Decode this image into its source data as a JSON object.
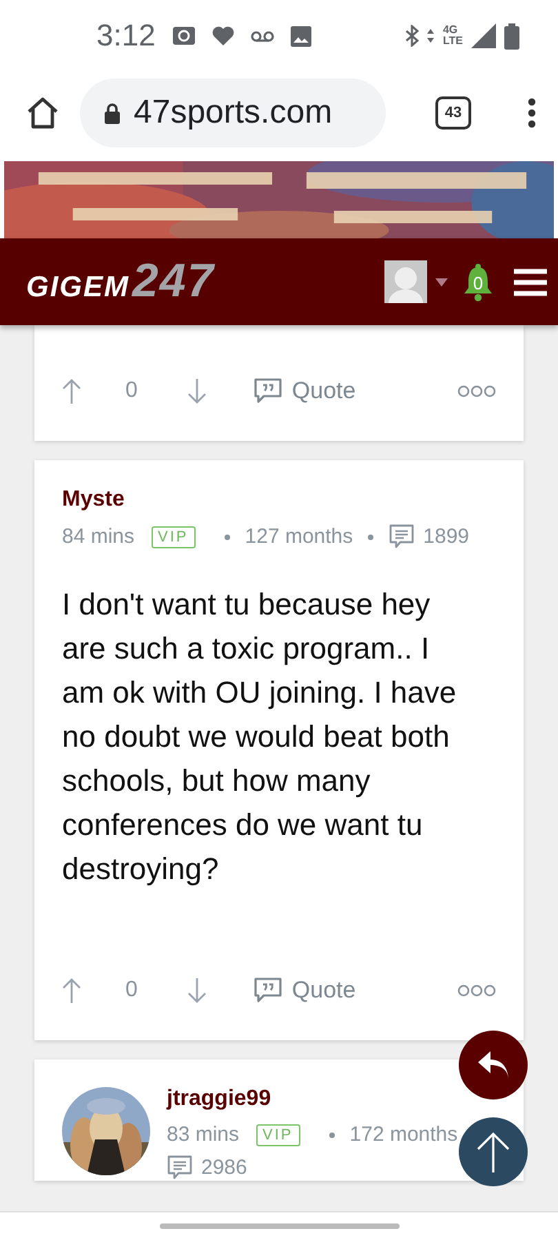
{
  "status_bar": {
    "time": "3:12",
    "network_top": "4G",
    "network_bottom": "LTE"
  },
  "browser": {
    "url": "47sports.com",
    "tab_count": "43"
  },
  "site_header": {
    "logo_main": "GIGEM",
    "logo_number": "247",
    "notifications": "0"
  },
  "posts": [
    {
      "votes": "0",
      "quote_label": "Quote"
    },
    {
      "author": "Myste",
      "time": "84 mins",
      "badge": "VIP",
      "tenure": "127 months",
      "post_count": "1899",
      "body": "I don't want tu because hey are such a toxic program.. I am ok with OU joining. I have no doubt we would beat both schools, but how many conferences do we want tu destroying?",
      "votes": "0",
      "quote_label": "Quote"
    },
    {
      "author": "jtraggie99",
      "avatar": true,
      "time": "83 mins",
      "badge": "VIP",
      "tenure": "172 months",
      "post_count": "2986"
    }
  ]
}
